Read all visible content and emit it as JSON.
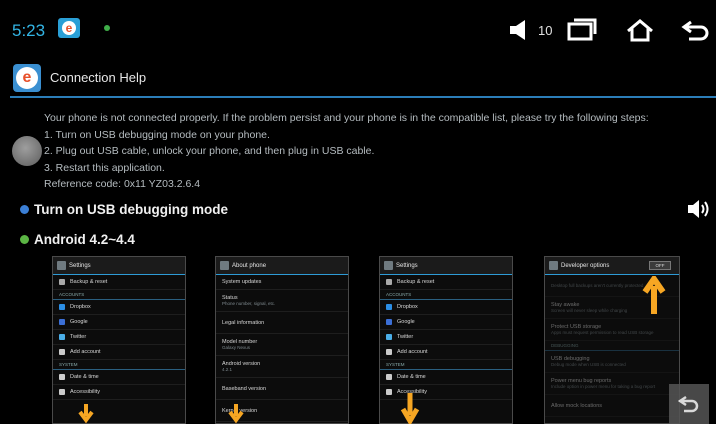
{
  "status_bar": {
    "time": "5:23",
    "volume_level": "10",
    "icons": [
      "app-icon",
      "usb-icon",
      "volume-icon",
      "recents-icon",
      "home-icon",
      "back-icon"
    ]
  },
  "app": {
    "title": "Connection Help"
  },
  "message": {
    "intro": "Your phone is not connected properly. If the problem persist and your phone is in the compatible list, please try the following steps:",
    "step1": "1. Turn on USB debugging mode on your phone.",
    "step2": "2. Plug out USB cable, unlock your phone, and then plug in USB cable.",
    "step3": "3. Restart this application.",
    "reference": "Reference code: 0x11 YZ03.2.6.4"
  },
  "sections": {
    "usb_debugging": "Turn on USB debugging mode",
    "android_version": "Android 4.2~4.4"
  },
  "colors": {
    "accent": "#33b5e5",
    "blue_bullet": "#3b7fd6",
    "green_bullet": "#5bb544",
    "arrow": "#f6a623"
  },
  "screenshots": {
    "settings1": {
      "header": "Settings",
      "backup": "Backup & reset",
      "accounts_cat": "ACCOUNTS",
      "dropbox": "Dropbox",
      "google": "Google",
      "twitter": "Twitter",
      "add_account": "Add account",
      "system_cat": "SYSTEM",
      "date_time": "Date & time",
      "accessibility": "Accessibility"
    },
    "about": {
      "header": "About phone",
      "updates": "System updates",
      "status": "Status",
      "status_sub": "Phone number, signal, etc.",
      "legal": "Legal information",
      "model": "Model number",
      "model_sub": "Galaxy Nexus",
      "android": "Android version",
      "android_sub": "4.2.1",
      "baseband": "Baseband version",
      "kernel": "Kernel version"
    },
    "settings2": {
      "header": "Settings",
      "backup": "Backup & reset",
      "accounts_cat": "ACCOUNTS",
      "dropbox": "Dropbox",
      "google": "Google",
      "twitter": "Twitter",
      "add_account": "Add account",
      "system_cat": "SYSTEM",
      "date_time": "Date & time",
      "accessibility": "Accessibility"
    },
    "developer": {
      "header": "Developer options",
      "toggle": "OFF",
      "backup_pw": "Desktop full backups aren't currently protected",
      "stay_awake": "Stay awake",
      "stay_awake_sub": "Screen will never sleep while charging",
      "protect_usb": "Protect USB storage",
      "protect_usb_sub": "Apps must request permission to read USB storage",
      "debugging_cat": "DEBUGGING",
      "usb_debugging": "USB debugging",
      "usb_debugging_sub": "Debug mode when USB is connected",
      "power_menu": "Power menu bug reports",
      "power_menu_sub": "Include option in power menu for taking a bug report",
      "mock_locations": "Allow mock locations"
    }
  }
}
